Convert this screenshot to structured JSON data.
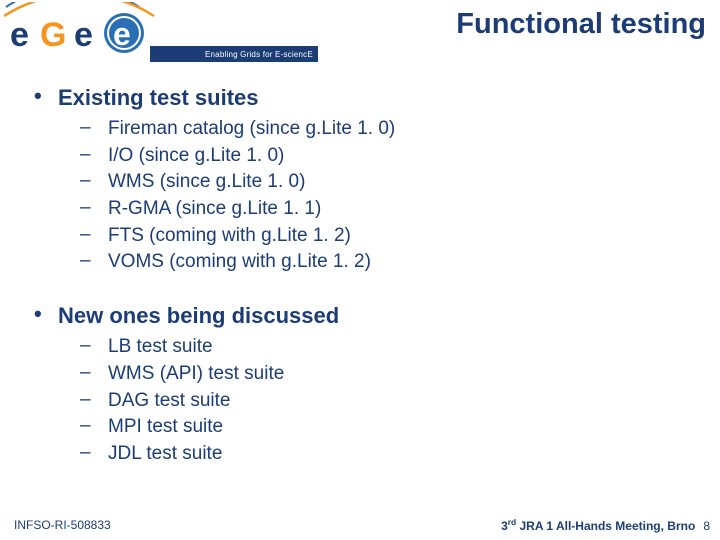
{
  "header": {
    "tagline": "Enabling Grids for E-sciencE",
    "title": "Functional testing",
    "logo_alt": "EGEE logo"
  },
  "body": {
    "sections": [
      {
        "heading": "Existing test suites",
        "items": [
          "Fireman catalog (since g.Lite 1. 0)",
          "I/O (since g.Lite 1. 0)",
          "WMS (since g.Lite 1. 0)",
          "R-GMA (since g.Lite 1. 1)",
          "FTS (coming with g.Lite 1. 2)",
          "VOMS (coming with g.Lite 1. 2)"
        ]
      },
      {
        "heading": "New ones being discussed",
        "items": [
          "LB test suite",
          "WMS (API) test suite",
          "DAG test suite",
          "MPI test suite",
          "JDL test suite"
        ]
      }
    ]
  },
  "footer": {
    "left": "INFSO-RI-508833",
    "right_prefix": "3",
    "right_sup": "rd",
    "right_rest": " JRA 1 All-Hands Meeting, Brno",
    "page": "8"
  },
  "colors": {
    "brand_dark": "#1b3c74",
    "brand_orange": "#f7941d",
    "brand_blue": "#2a6fb3"
  }
}
